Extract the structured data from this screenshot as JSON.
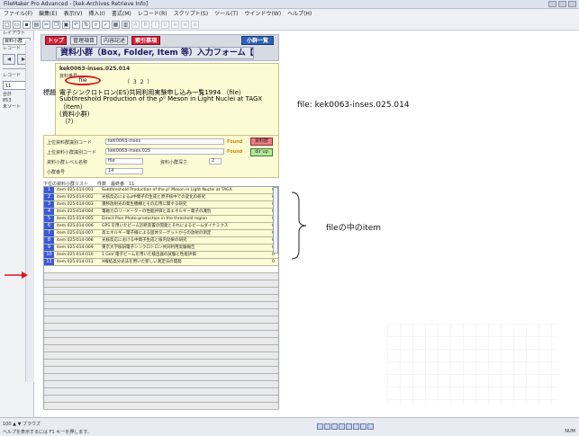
{
  "window": {
    "title": "FileMaker Pro Advanced - [kek-Archives Retrieve Info]"
  },
  "menu": [
    "ファイル(F)",
    "編集(E)",
    "表示(V)",
    "挿入(I)",
    "書式(M)",
    "レコード(R)",
    "スクリプト(S)",
    "ツール(T)",
    "ウインドウ(W)",
    "ヘルプ(H)"
  ],
  "leftpanel": {
    "layout_label": "レイアウト",
    "layout_value": "資料小群",
    "record_label": "レコード",
    "record_value": "11",
    "total_label": "合計",
    "total_value": "853",
    "sort_label": "未ソート"
  },
  "form": {
    "btn_top": "トップ",
    "btn_manage": "管理項目",
    "btn_content": "内容記述",
    "btn_catalog": "索引事項",
    "btn_list": "小群一覧",
    "title": "資料小群（Box, Folder, Item 等）入力フォーム【トップ】"
  },
  "record": {
    "id": "kek0063-inses.025.014",
    "sublabel": "資料番号",
    "level": "file",
    "count": "（ 3 2 ）",
    "title_label": "標題",
    "line1": "電子シンクロトロン(ES)共同利用実験申し込み一覧1994 （file）",
    "line2": "Subthreshold Production of the ρ⁰ Meson in Light Nuclei at TAGX",
    "line3": "（item）",
    "line4": "(資料小群)",
    "line5": "（?）"
  },
  "upper": {
    "label1": "上位資料群識別コード",
    "value1": "kek0063-inses",
    "found1": "Found",
    "btn1": "資料群",
    "label2": "上位資料小群識別コード",
    "value2": "kek0063-inses.025",
    "found2": "Found",
    "btn2": "dir up",
    "label3": "資料小群レベル名称",
    "value3": "file",
    "label3b": "資料小群深さ",
    "value3b": "2",
    "label4": "小群番号",
    "value4": "14"
  },
  "list": {
    "header": "下位の資料小群リスト　　件数　最終番　11",
    "rows": [
      {
        "num": "1",
        "id": "item 025-014-001",
        "title": "Subthreshold Production of the ρ⁰ Meson in Light Nuclei at TAGX",
        "count": "0"
      },
      {
        "num": "2",
        "id": "item 025-014-002",
        "title": "光核反応によるρ中間子の生成と原子核中での変化の研究",
        "count": "0"
      },
      {
        "num": "3",
        "id": "item 025-014-003",
        "title": "遷移放射光の発生機構とその応用に関する研究",
        "count": "0"
      },
      {
        "num": "4",
        "id": "item 025-014-004",
        "title": "電磁カロリーメーターの性能評価と高エネルギー電子の識別",
        "count": "0"
      },
      {
        "num": "5",
        "id": "item 025-014-005",
        "title": "Direct Pion Photo-production in the threshold region",
        "count": "0"
      },
      {
        "num": "6",
        "id": "item 025-014-006",
        "title": "GPS を用いたビーム診断装置の開発とそれによるビームダイナミクス",
        "count": "0"
      },
      {
        "num": "7",
        "id": "item 025-014-007",
        "title": "高エネルギー電子線による固体ターゲットからの放射の測定",
        "count": "0"
      },
      {
        "num": "8",
        "id": "item 025-014-008",
        "title": "光核反応における中間子生成と核内効果の研究",
        "count": "0"
      },
      {
        "num": "9",
        "id": "item 025-014-009",
        "title": "東京大学核研電子シンクロトロン共同利用実験報告",
        "count": "0"
      },
      {
        "num": "10",
        "id": "item 025-014-010",
        "title": "1 GeV 電子ビームを用いた検出器の試験と性能評価",
        "count": "0"
      },
      {
        "num": "11",
        "id": "item 025-014-011",
        "title": "X線結晶分光法を用いた新しい測定法の開発",
        "count": "0"
      }
    ],
    "empty_rows": 20
  },
  "annotations": {
    "file": "file: kek0063-inses.025.014",
    "item": "fileの中のitem"
  },
  "status": {
    "left1": "100   ▲  ▼  ブラウズ",
    "left2": "ヘルプを表示するには F1 キーを押します。",
    "right": "NUM"
  },
  "colors": {
    "red_button": "#d5233b",
    "blue_button": "#2f5fb8",
    "row_number": "#3b59d9",
    "form_bg": "#fdfbd4",
    "annotation_red": "#d81818"
  }
}
